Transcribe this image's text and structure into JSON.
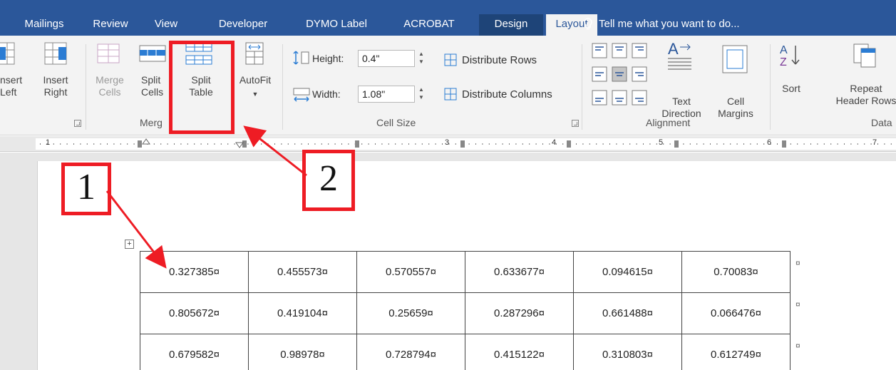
{
  "tabs": [
    "Mailings",
    "Review",
    "View",
    "Developer",
    "DYMO Label",
    "ACROBAT",
    "Design",
    "Layout"
  ],
  "tell_me": "Tell me what you want to do...",
  "ribbon": {
    "insert_left": "nsert\nLeft",
    "insert_right": "Insert\nRight",
    "merge_cells": "Merge\nCells",
    "split_cells": "Split\nCells",
    "split_table": "Split\nTable",
    "autofit": "AutoFit",
    "height_label": "Height:",
    "height_value": "0.4\"",
    "width_label": "Width:",
    "width_value": "1.08\"",
    "distribute_rows": "Distribute Rows",
    "distribute_columns": "Distribute Columns",
    "text_direction": "Text\nDirection",
    "cell_margins": "Cell\nMargins",
    "sort": "Sort",
    "repeat_header_rows": "Repeat\nHeader Rows",
    "group_merge": "Merg",
    "group_cell_size": "Cell Size",
    "group_alignment": "Alignment",
    "group_data": "Data"
  },
  "ruler_numbers": [
    "1",
    "3",
    "4",
    "5",
    "6",
    "7"
  ],
  "table": [
    [
      "0.327385¤",
      "0.455573¤",
      "0.570557¤",
      "0.633677¤",
      "0.094615¤",
      "0.70083¤"
    ],
    [
      "0.805672¤",
      "0.419104¤",
      "0.25659¤",
      "0.287296¤",
      "0.661488¤",
      "0.066476¤"
    ],
    [
      "0.679582¤",
      "0.98978¤",
      "0.728794¤",
      "0.415122¤",
      "0.310803¤",
      "0.612749¤"
    ]
  ],
  "row_end_mark": "¤",
  "move_handle": "+",
  "annotations": {
    "one": "1",
    "two": "2"
  },
  "colors": {
    "ribbon_blue": "#2b579a",
    "annotation_red": "#ee1c24"
  }
}
